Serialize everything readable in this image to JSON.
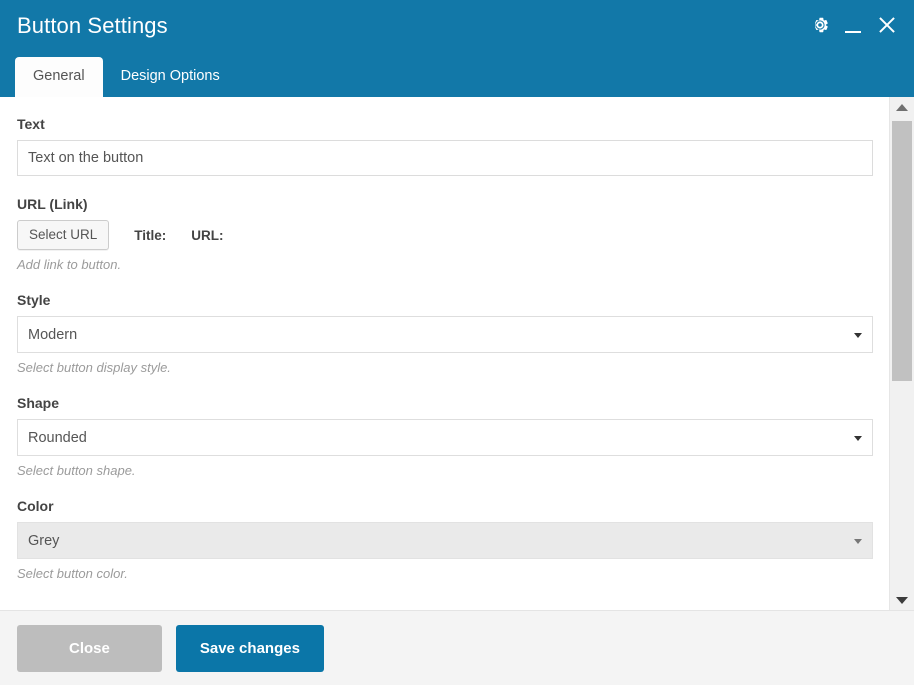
{
  "window": {
    "title": "Button Settings",
    "controls": [
      {
        "name": "settings-gear",
        "label": "Settings"
      },
      {
        "name": "minimize",
        "label": "Minimize"
      },
      {
        "name": "close",
        "label": "Close"
      }
    ]
  },
  "tabs": [
    {
      "label": "General",
      "active": true
    },
    {
      "label": "Design Options",
      "active": false
    }
  ],
  "fields": {
    "text": {
      "label": "Text",
      "value": "Text on the button",
      "placeholder": ""
    },
    "url": {
      "label": "URL (Link)",
      "button_label": "Select URL",
      "title_label": "Title:",
      "title_value": "",
      "url_label": "URL:",
      "url_value": "",
      "description": "Add link to button."
    },
    "style": {
      "label": "Style",
      "value": "Modern",
      "description": "Select button display style."
    },
    "shape": {
      "label": "Shape",
      "value": "Rounded",
      "description": "Select button shape."
    },
    "color": {
      "label": "Color",
      "value": "Grey",
      "description": "Select button color.",
      "disabled": true
    }
  },
  "footer": {
    "close_label": "Close",
    "save_label": "Save changes"
  },
  "colors": {
    "header_blue": "#1278a8",
    "save_blue": "#0b76a8",
    "close_grey": "#bdbdbd",
    "footer_bg": "#f4f4f4",
    "scrollbar_thumb": "#c1c1c1"
  }
}
